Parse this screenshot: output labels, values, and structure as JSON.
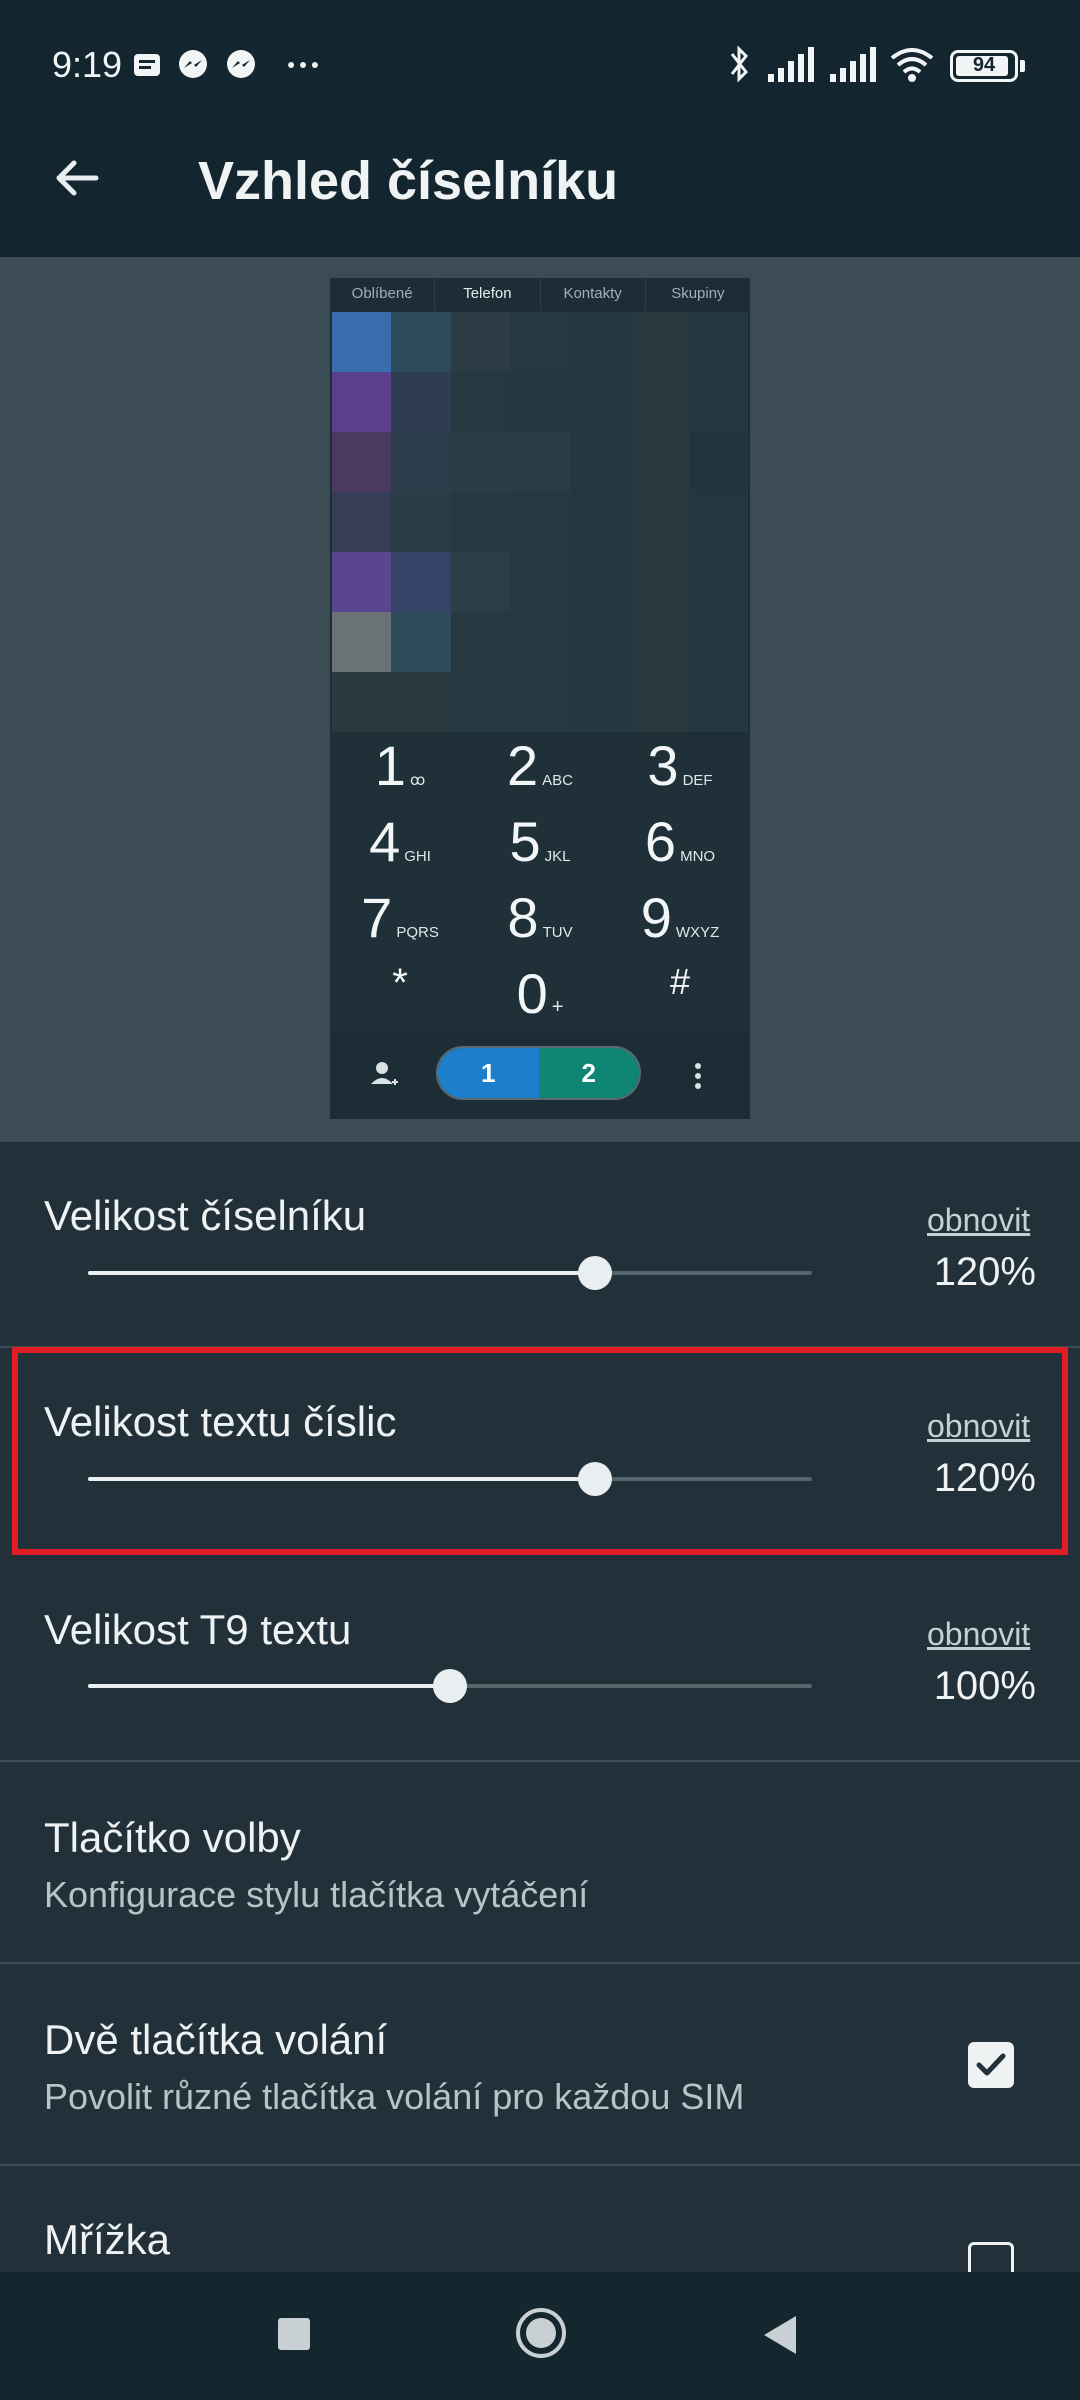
{
  "status_bar": {
    "time": "9:19",
    "battery": "94",
    "battery_level_pct": 94,
    "left_icons": [
      "notes-icon",
      "messenger-icon",
      "messenger-icon",
      "more-dots-icon"
    ],
    "right_icons": [
      "bluetooth-icon",
      "signal-icon",
      "signal-icon",
      "wifi-icon",
      "battery-icon"
    ]
  },
  "app_bar": {
    "back_icon": "arrow-back-icon",
    "title": "Vzhled číselníku"
  },
  "preview": {
    "tabs": [
      "Oblíbené",
      "Telefon",
      "Kontakty",
      "Skupiny"
    ],
    "active_tab": "Telefon",
    "keys": [
      {
        "digit": "1",
        "letters": "ꝏ"
      },
      {
        "digit": "2",
        "letters": "ABC"
      },
      {
        "digit": "3",
        "letters": "DEF"
      },
      {
        "digit": "4",
        "letters": "GHI"
      },
      {
        "digit": "5",
        "letters": "JKL"
      },
      {
        "digit": "6",
        "letters": "MNO"
      },
      {
        "digit": "7",
        "letters": "PQRS"
      },
      {
        "digit": "8",
        "letters": "TUV"
      },
      {
        "digit": "9",
        "letters": "WXYZ"
      },
      {
        "digit": "*",
        "letters": ""
      },
      {
        "digit": "0",
        "letters": "+"
      },
      {
        "digit": "#",
        "letters": ""
      }
    ],
    "sim1_label": "1",
    "sim2_label": "2",
    "sim1_color": "#1d7fcb",
    "sim2_color": "#0f8573"
  },
  "settings": {
    "dial_size": {
      "title": "Velikost číselníku",
      "reset": "obnovit",
      "value": "120%",
      "slider_fraction": 0.7
    },
    "digit_text_size": {
      "title": "Velikost textu číslic",
      "reset": "obnovit",
      "value": "120%",
      "slider_fraction": 0.7
    },
    "t9_text_size": {
      "title": "Velikost T9 textu",
      "reset": "obnovit",
      "value": "100%",
      "slider_fraction": 0.5
    },
    "call_button": {
      "title": "Tlačítko volby",
      "subtitle": "Konfigurace stylu tlačítka vytáčení"
    },
    "two_call_buttons": {
      "title": "Dvě tlačítka volání",
      "subtitle": "Povolit různé tlačítka volání pro každou SIM",
      "checked": true
    },
    "grid": {
      "title": "Mřížka",
      "checked": false
    }
  },
  "colors": {
    "background": "#223139",
    "toolbar": "#13262f",
    "highlight": "#e21d26"
  },
  "nav_bar": [
    "recents-square-icon",
    "home-circle-icon",
    "back-triangle-icon"
  ]
}
